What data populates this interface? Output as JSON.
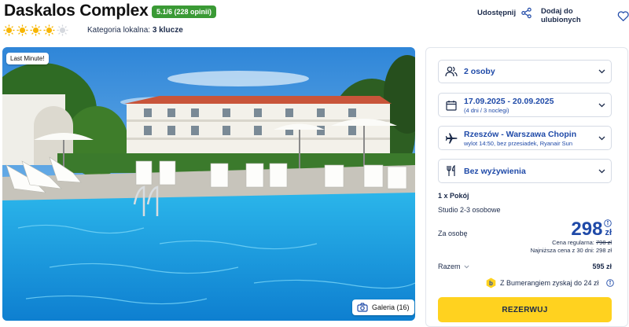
{
  "hotel": {
    "name": "Daskalos Complex",
    "rating": "5.1/6 (228 opinii)",
    "stars": 4.5,
    "category_label": "Kategoria lokalna:",
    "category_value": "3 klucze"
  },
  "actions": {
    "share": "Udostępnij",
    "favorite": "Dodaj do ulubionych"
  },
  "photo": {
    "badge": "Last Minute!",
    "gallery": "Galeria (16)"
  },
  "booking": {
    "guests": "2 osoby",
    "dates": "17.09.2025 - 20.09.2025",
    "dates_sub": "(4 dni / 3 noclegi)",
    "flight": "Rzeszów - Warszawa Chopin",
    "flight_sub": "wylot 14:50, bez przesiadek, Ryanair Sun",
    "board": "Bez wyżywienia",
    "room_count": "1 x Pokój",
    "room_type": "Studio 2-3 osobowe",
    "per_person_label": "Za osobę",
    "price": "298",
    "currency": "zł",
    "regular_label": "Cena regularna:",
    "regular_price": "798 zł",
    "lowest_30": "Najniższa cena z 30 dni: 298 zł",
    "total_label": "Razem",
    "total_value": "595 zł",
    "bumerang": "Z Bumerangiem zyskaj do 24 zł",
    "reserve": "REZERWUJ"
  },
  "colors": {
    "accent_blue": "#1f4aa8",
    "rating_green": "#3a9a35",
    "button_yellow": "#ffd21f",
    "sun_yellow": "#f7b500"
  }
}
